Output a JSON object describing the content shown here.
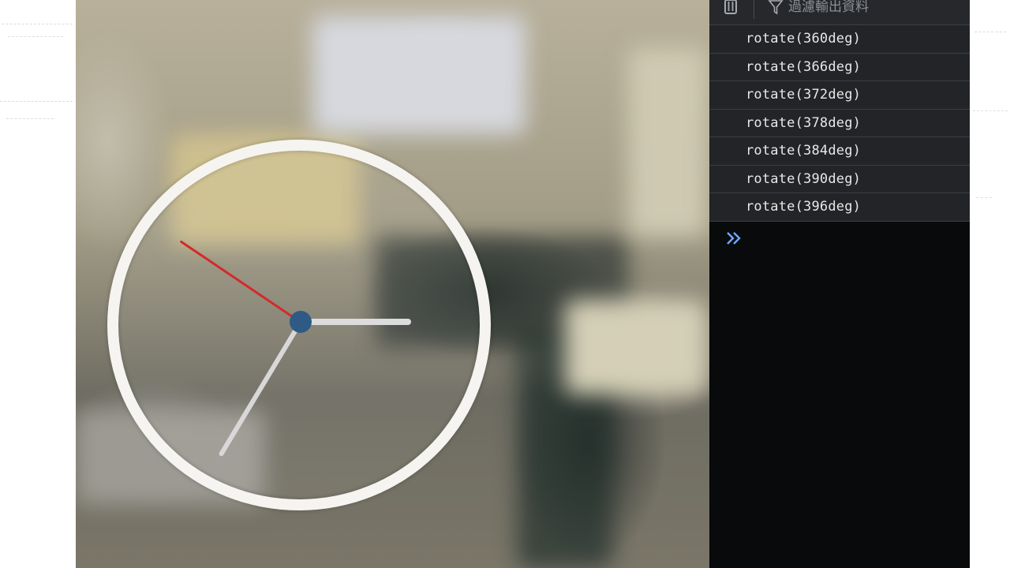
{
  "clock": {
    "hub_color": "#2f5a86",
    "second_hand_color": "#d42a2a",
    "hand_color": "#dcdcdc",
    "rim_color": "#f5f4f0"
  },
  "console": {
    "toolbar": {
      "clear_icon": "trash-icon",
      "filter_icon": "filter-icon",
      "filter_placeholder": "過濾輸出資料"
    },
    "logs": [
      "rotate(360deg)",
      "rotate(366deg)",
      "rotate(372deg)",
      "rotate(378deg)",
      "rotate(384deg)",
      "rotate(390deg)",
      "rotate(396deg)"
    ],
    "prompt_icon": "chevron-double-right-icon",
    "prompt_color": "#6fa8ff"
  }
}
